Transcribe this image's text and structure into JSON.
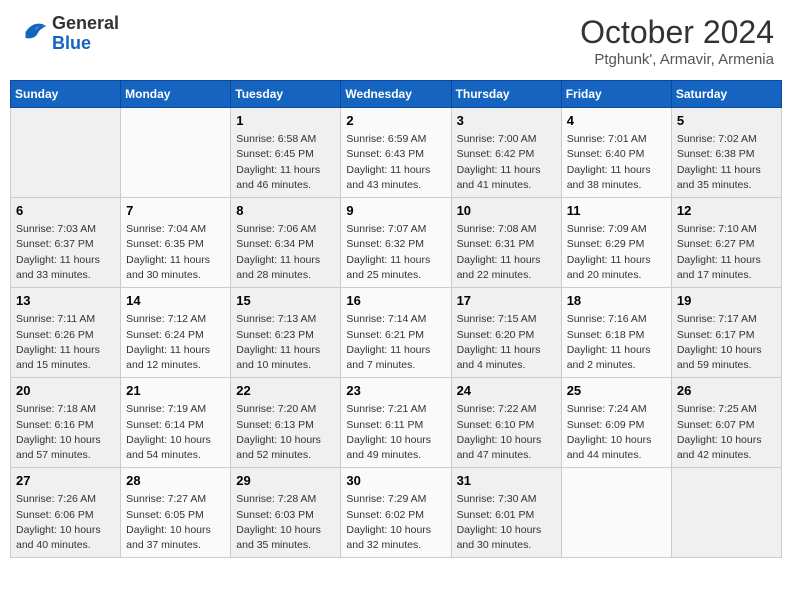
{
  "header": {
    "logo_general": "General",
    "logo_blue": "Blue",
    "title": "October 2024",
    "subtitle": "Ptghunk', Armavir, Armenia"
  },
  "weekdays": [
    "Sunday",
    "Monday",
    "Tuesday",
    "Wednesday",
    "Thursday",
    "Friday",
    "Saturday"
  ],
  "weeks": [
    [
      {
        "day": "",
        "sunrise": "",
        "sunset": "",
        "daylight": ""
      },
      {
        "day": "",
        "sunrise": "",
        "sunset": "",
        "daylight": ""
      },
      {
        "day": "1",
        "sunrise": "Sunrise: 6:58 AM",
        "sunset": "Sunset: 6:45 PM",
        "daylight": "Daylight: 11 hours and 46 minutes."
      },
      {
        "day": "2",
        "sunrise": "Sunrise: 6:59 AM",
        "sunset": "Sunset: 6:43 PM",
        "daylight": "Daylight: 11 hours and 43 minutes."
      },
      {
        "day": "3",
        "sunrise": "Sunrise: 7:00 AM",
        "sunset": "Sunset: 6:42 PM",
        "daylight": "Daylight: 11 hours and 41 minutes."
      },
      {
        "day": "4",
        "sunrise": "Sunrise: 7:01 AM",
        "sunset": "Sunset: 6:40 PM",
        "daylight": "Daylight: 11 hours and 38 minutes."
      },
      {
        "day": "5",
        "sunrise": "Sunrise: 7:02 AM",
        "sunset": "Sunset: 6:38 PM",
        "daylight": "Daylight: 11 hours and 35 minutes."
      }
    ],
    [
      {
        "day": "6",
        "sunrise": "Sunrise: 7:03 AM",
        "sunset": "Sunset: 6:37 PM",
        "daylight": "Daylight: 11 hours and 33 minutes."
      },
      {
        "day": "7",
        "sunrise": "Sunrise: 7:04 AM",
        "sunset": "Sunset: 6:35 PM",
        "daylight": "Daylight: 11 hours and 30 minutes."
      },
      {
        "day": "8",
        "sunrise": "Sunrise: 7:06 AM",
        "sunset": "Sunset: 6:34 PM",
        "daylight": "Daylight: 11 hours and 28 minutes."
      },
      {
        "day": "9",
        "sunrise": "Sunrise: 7:07 AM",
        "sunset": "Sunset: 6:32 PM",
        "daylight": "Daylight: 11 hours and 25 minutes."
      },
      {
        "day": "10",
        "sunrise": "Sunrise: 7:08 AM",
        "sunset": "Sunset: 6:31 PM",
        "daylight": "Daylight: 11 hours and 22 minutes."
      },
      {
        "day": "11",
        "sunrise": "Sunrise: 7:09 AM",
        "sunset": "Sunset: 6:29 PM",
        "daylight": "Daylight: 11 hours and 20 minutes."
      },
      {
        "day": "12",
        "sunrise": "Sunrise: 7:10 AM",
        "sunset": "Sunset: 6:27 PM",
        "daylight": "Daylight: 11 hours and 17 minutes."
      }
    ],
    [
      {
        "day": "13",
        "sunrise": "Sunrise: 7:11 AM",
        "sunset": "Sunset: 6:26 PM",
        "daylight": "Daylight: 11 hours and 15 minutes."
      },
      {
        "day": "14",
        "sunrise": "Sunrise: 7:12 AM",
        "sunset": "Sunset: 6:24 PM",
        "daylight": "Daylight: 11 hours and 12 minutes."
      },
      {
        "day": "15",
        "sunrise": "Sunrise: 7:13 AM",
        "sunset": "Sunset: 6:23 PM",
        "daylight": "Daylight: 11 hours and 10 minutes."
      },
      {
        "day": "16",
        "sunrise": "Sunrise: 7:14 AM",
        "sunset": "Sunset: 6:21 PM",
        "daylight": "Daylight: 11 hours and 7 minutes."
      },
      {
        "day": "17",
        "sunrise": "Sunrise: 7:15 AM",
        "sunset": "Sunset: 6:20 PM",
        "daylight": "Daylight: 11 hours and 4 minutes."
      },
      {
        "day": "18",
        "sunrise": "Sunrise: 7:16 AM",
        "sunset": "Sunset: 6:18 PM",
        "daylight": "Daylight: 11 hours and 2 minutes."
      },
      {
        "day": "19",
        "sunrise": "Sunrise: 7:17 AM",
        "sunset": "Sunset: 6:17 PM",
        "daylight": "Daylight: 10 hours and 59 minutes."
      }
    ],
    [
      {
        "day": "20",
        "sunrise": "Sunrise: 7:18 AM",
        "sunset": "Sunset: 6:16 PM",
        "daylight": "Daylight: 10 hours and 57 minutes."
      },
      {
        "day": "21",
        "sunrise": "Sunrise: 7:19 AM",
        "sunset": "Sunset: 6:14 PM",
        "daylight": "Daylight: 10 hours and 54 minutes."
      },
      {
        "day": "22",
        "sunrise": "Sunrise: 7:20 AM",
        "sunset": "Sunset: 6:13 PM",
        "daylight": "Daylight: 10 hours and 52 minutes."
      },
      {
        "day": "23",
        "sunrise": "Sunrise: 7:21 AM",
        "sunset": "Sunset: 6:11 PM",
        "daylight": "Daylight: 10 hours and 49 minutes."
      },
      {
        "day": "24",
        "sunrise": "Sunrise: 7:22 AM",
        "sunset": "Sunset: 6:10 PM",
        "daylight": "Daylight: 10 hours and 47 minutes."
      },
      {
        "day": "25",
        "sunrise": "Sunrise: 7:24 AM",
        "sunset": "Sunset: 6:09 PM",
        "daylight": "Daylight: 10 hours and 44 minutes."
      },
      {
        "day": "26",
        "sunrise": "Sunrise: 7:25 AM",
        "sunset": "Sunset: 6:07 PM",
        "daylight": "Daylight: 10 hours and 42 minutes."
      }
    ],
    [
      {
        "day": "27",
        "sunrise": "Sunrise: 7:26 AM",
        "sunset": "Sunset: 6:06 PM",
        "daylight": "Daylight: 10 hours and 40 minutes."
      },
      {
        "day": "28",
        "sunrise": "Sunrise: 7:27 AM",
        "sunset": "Sunset: 6:05 PM",
        "daylight": "Daylight: 10 hours and 37 minutes."
      },
      {
        "day": "29",
        "sunrise": "Sunrise: 7:28 AM",
        "sunset": "Sunset: 6:03 PM",
        "daylight": "Daylight: 10 hours and 35 minutes."
      },
      {
        "day": "30",
        "sunrise": "Sunrise: 7:29 AM",
        "sunset": "Sunset: 6:02 PM",
        "daylight": "Daylight: 10 hours and 32 minutes."
      },
      {
        "day": "31",
        "sunrise": "Sunrise: 7:30 AM",
        "sunset": "Sunset: 6:01 PM",
        "daylight": "Daylight: 10 hours and 30 minutes."
      },
      {
        "day": "",
        "sunrise": "",
        "sunset": "",
        "daylight": ""
      },
      {
        "day": "",
        "sunrise": "",
        "sunset": "",
        "daylight": ""
      }
    ]
  ]
}
